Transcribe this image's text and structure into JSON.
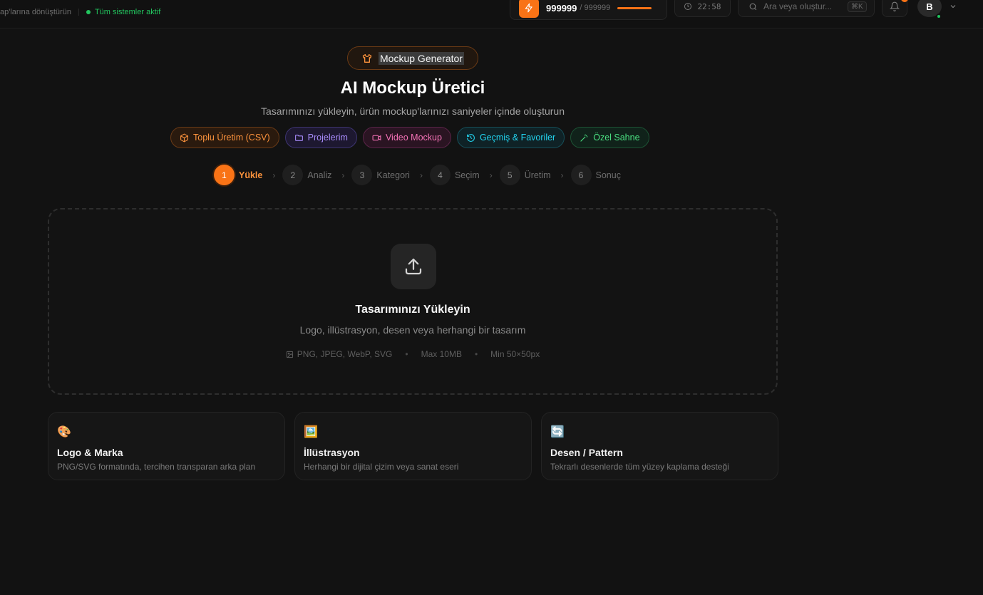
{
  "topbar": {
    "tagline": "ap'larına dönüştürün",
    "status": "Tüm sistemler aktif",
    "credits_value": "999999",
    "credits_max": "/ 999999",
    "credits_fraction": 1.0,
    "clock": "22:58",
    "search_placeholder": "Ara veya oluştur...",
    "search_shortcut": "⌘K",
    "avatar_initial": "B"
  },
  "header": {
    "badge": "Mockup Generator",
    "title": "AI Mockup Üretici",
    "subtitle": "Tasarımınızı yükleyin, ürün mockup'larınızı saniyeler içinde oluşturun"
  },
  "actions": [
    {
      "label": "Toplu Üretim (CSV)",
      "icon": "box-icon",
      "color": "#fb923c"
    },
    {
      "label": "Projelerim",
      "icon": "folder-icon",
      "color": "#a78bfa"
    },
    {
      "label": "Video Mockup",
      "icon": "video-icon",
      "color": "#f472b6"
    },
    {
      "label": "Geçmiş & Favoriler",
      "icon": "history-icon",
      "color": "#22d3ee"
    },
    {
      "label": "Özel Sahne",
      "icon": "wand-icon",
      "color": "#4ade80"
    }
  ],
  "steps": [
    {
      "num": "1",
      "label": "Yükle",
      "active": true
    },
    {
      "num": "2",
      "label": "Analiz"
    },
    {
      "num": "3",
      "label": "Kategori"
    },
    {
      "num": "4",
      "label": "Seçim"
    },
    {
      "num": "5",
      "label": "Üretim"
    },
    {
      "num": "6",
      "label": "Sonuç"
    }
  ],
  "upload": {
    "title": "Tasarımınızı Yükleyin",
    "description": "Logo, illüstrasyon, desen veya herhangi bir tasarım",
    "formats": "PNG, JPEG, WebP, SVG",
    "max_size": "Max 10MB",
    "min_dims": "Min 50×50px"
  },
  "cards": [
    {
      "emoji": "🎨",
      "title": "Logo & Marka",
      "desc": "PNG/SVG formatında, tercihen transparan arka plan"
    },
    {
      "emoji": "🖼️",
      "title": "İllüstrasyon",
      "desc": "Herhangi bir dijital çizim veya sanat eseri"
    },
    {
      "emoji": "🔄",
      "title": "Desen / Pattern",
      "desc": "Tekrarlı desenlerde tüm yüzey kaplama desteği"
    }
  ],
  "colors": {
    "accent": "#f97316",
    "status": "#22c55e",
    "background": "#121212"
  }
}
